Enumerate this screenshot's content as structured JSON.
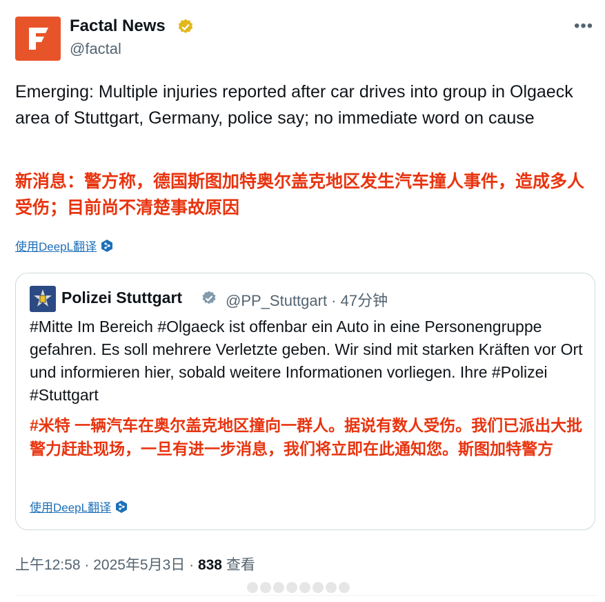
{
  "author": {
    "name": "Factal News",
    "handle": "@factal"
  },
  "tweet": {
    "text": "Emerging: Multiple injuries reported after car drives into group in Olgaeck area of Stuttgart, Germany, police say; no immediate word on cause",
    "translation": "新消息：警方称，德国斯图加特奥尔盖克地区发生汽车撞人事件，造成多人受伤；目前尚不清楚事故原因",
    "translate_link": "使用DeepL翻译"
  },
  "quote": {
    "name": "Polizei Stuttgart",
    "handle": "@PP_Stuttgart · 47分钟",
    "text": "#Mitte Im Bereich #Olgaeck ist offenbar ein Auto in eine Personengruppe gefahren. Es soll mehrere Verletzte geben. Wir sind mit starken Kräften vor Ort und informieren hier, sobald weitere Informationen vorliegen. Ihre #Polizei #Stuttgart",
    "translation": "#米特 一辆汽车在奥尔盖克地区撞向一群人。据说有数人受伤。我们已派出大批警力赶赴现场，一旦有进一步消息，我们将立即在此通知您。斯图加特警方",
    "translate_link": "使用DeepL翻译"
  },
  "meta": {
    "time": "上午12:58 · 2025年5月3日 · ",
    "views": "838",
    "views_label": " 查看"
  },
  "colors": {
    "brand": "#e8542a",
    "translation": "#e8340f",
    "link": "#1d6fb8",
    "verified_gold": "#e2b719",
    "verified_gray": "#829aab"
  },
  "icons": {
    "more": "more-icon",
    "verified": "verified-badge-icon",
    "translate": "deepl-icon"
  }
}
